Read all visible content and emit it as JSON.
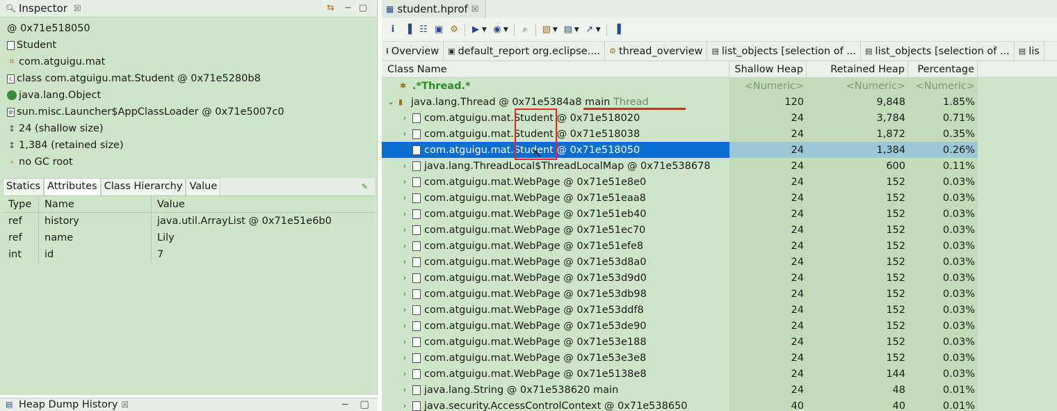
{
  "inspector": {
    "title": "Inspector",
    "lines": [
      {
        "icon": "at-icon",
        "text": "@ 0x71e518050"
      },
      {
        "icon": "page-icon",
        "text": "Student"
      },
      {
        "icon": "package-icon",
        "text": "com.atguigu.mat"
      },
      {
        "icon": "class-icon",
        "text": "class com.atguigu.mat.Student @ 0x71e5280b8"
      },
      {
        "icon": "object-icon",
        "text": "java.lang.Object"
      },
      {
        "icon": "classloader-icon",
        "text": "sun.misc.Launcher$AppClassLoader @ 0x71e5007c0"
      },
      {
        "icon": "size-icon",
        "text": "24 (shallow size)"
      },
      {
        "icon": "size-icon",
        "text": "1,384 (retained size)"
      },
      {
        "icon": "gc-root-icon",
        "text": "no GC root"
      }
    ],
    "tabs": [
      "Statics",
      "Attributes",
      "Class Hierarchy",
      "Value"
    ],
    "active_tab": "Attributes",
    "table": {
      "headers": [
        "Type",
        "Name",
        "Value"
      ],
      "rows": [
        {
          "type": "ref",
          "name": "history",
          "value": "java.util.ArrayList @ 0x71e51e6b0"
        },
        {
          "type": "ref",
          "name": "name",
          "value": "Lily"
        },
        {
          "type": "int",
          "name": "id",
          "value": "7"
        }
      ]
    }
  },
  "heap_history": {
    "title": "Heap Dump History"
  },
  "editor": {
    "tab_title": "student.hprof",
    "subtabs": [
      "Overview",
      "default_report  org.eclipse....",
      "thread_overview",
      "list_objects  [selection of ...",
      "list_objects  [selection of ...",
      "lis"
    ],
    "columns": [
      "Class Name",
      "Shallow Heap",
      "Retained Heap",
      "Percentage"
    ],
    "filter_row": {
      "name": ".*Thread.*",
      "shallow": "<Numeric>",
      "retained": "<Numeric>",
      "percentage": "<Numeric>"
    },
    "thread_row": {
      "name": "java.lang.Thread @ 0x71e5384a8  main",
      "suffix": "Thread",
      "shallow": "120",
      "retained": "9,848",
      "percentage": "1.85%"
    },
    "rows": [
      {
        "name": "com.atguigu.mat.Student @ 0x71e518020",
        "shallow": "24",
        "retained": "3,784",
        "percentage": "0.71%"
      },
      {
        "name": "com.atguigu.mat.Student @ 0x71e518038",
        "shallow": "24",
        "retained": "1,872",
        "percentage": "0.35%"
      },
      {
        "name": "com.atguigu.mat.Student @ 0x71e518050",
        "shallow": "24",
        "retained": "1,384",
        "percentage": "0.26%"
      },
      {
        "name": "java.lang.ThreadLocal$ThreadLocalMap @ 0x71e538678",
        "shallow": "24",
        "retained": "600",
        "percentage": "0.11%"
      },
      {
        "name": "com.atguigu.mat.WebPage @ 0x71e51e8e0",
        "shallow": "24",
        "retained": "152",
        "percentage": "0.03%"
      },
      {
        "name": "com.atguigu.mat.WebPage @ 0x71e51eaa8",
        "shallow": "24",
        "retained": "152",
        "percentage": "0.03%"
      },
      {
        "name": "com.atguigu.mat.WebPage @ 0x71e51eb40",
        "shallow": "24",
        "retained": "152",
        "percentage": "0.03%"
      },
      {
        "name": "com.atguigu.mat.WebPage @ 0x71e51ec70",
        "shallow": "24",
        "retained": "152",
        "percentage": "0.03%"
      },
      {
        "name": "com.atguigu.mat.WebPage @ 0x71e51efe8",
        "shallow": "24",
        "retained": "152",
        "percentage": "0.03%"
      },
      {
        "name": "com.atguigu.mat.WebPage @ 0x71e53d8a0",
        "shallow": "24",
        "retained": "152",
        "percentage": "0.03%"
      },
      {
        "name": "com.atguigu.mat.WebPage @ 0x71e53d9d0",
        "shallow": "24",
        "retained": "152",
        "percentage": "0.03%"
      },
      {
        "name": "com.atguigu.mat.WebPage @ 0x71e53db98",
        "shallow": "24",
        "retained": "152",
        "percentage": "0.03%"
      },
      {
        "name": "com.atguigu.mat.WebPage @ 0x71e53ddf8",
        "shallow": "24",
        "retained": "152",
        "percentage": "0.03%"
      },
      {
        "name": "com.atguigu.mat.WebPage @ 0x71e53de90",
        "shallow": "24",
        "retained": "152",
        "percentage": "0.03%"
      },
      {
        "name": "com.atguigu.mat.WebPage @ 0x71e53e188",
        "shallow": "24",
        "retained": "152",
        "percentage": "0.03%"
      },
      {
        "name": "com.atguigu.mat.WebPage @ 0x71e53e3e8",
        "shallow": "24",
        "retained": "152",
        "percentage": "0.03%"
      },
      {
        "name": "com.atguigu.mat.WebPage @ 0x71e5138e8",
        "shallow": "24",
        "retained": "144",
        "percentage": "0.03%"
      },
      {
        "name": "java.lang.String @ 0x71e538620  main",
        "shallow": "24",
        "retained": "48",
        "percentage": "0.01%"
      },
      {
        "name": "java.security.AccessControlContext @ 0x71e538650",
        "shallow": "40",
        "retained": "40",
        "percentage": "0.01%"
      }
    ],
    "selected_row": 2
  }
}
